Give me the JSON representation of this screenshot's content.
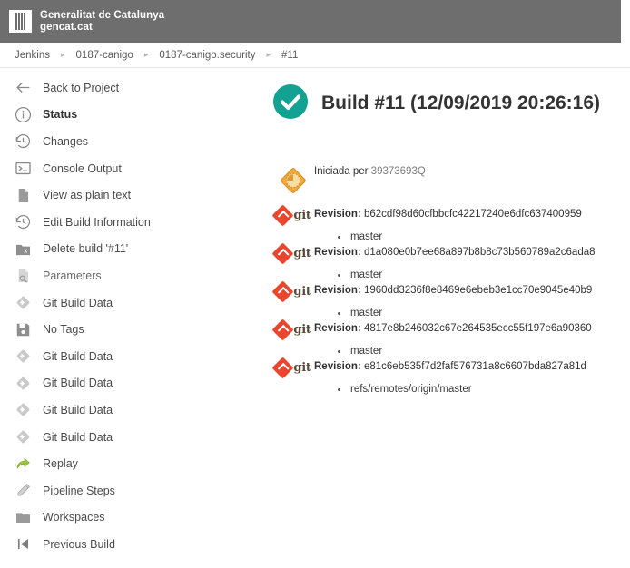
{
  "banner": {
    "org_line1": "Generalitat de Catalunya",
    "org_line2": "gencat.cat",
    "logo_icon": "catalan-flag-icon",
    "bg": "#6e6e6e"
  },
  "breadcrumb": {
    "separator": "▸",
    "items": [
      {
        "label": "Jenkins"
      },
      {
        "label": "0187-canigo"
      },
      {
        "label": "0187-canigo.security"
      },
      {
        "label": "#11"
      }
    ]
  },
  "sidebar": {
    "items": [
      {
        "label": "Back to Project",
        "icon": "arrow-left-icon",
        "state": "normal"
      },
      {
        "label": "Status",
        "icon": "info-icon",
        "state": "active"
      },
      {
        "label": "Changes",
        "icon": "history-icon",
        "state": "normal"
      },
      {
        "label": "Console Output",
        "icon": "terminal-icon",
        "state": "normal"
      },
      {
        "label": "View as plain text",
        "icon": "document-icon",
        "state": "normal"
      },
      {
        "label": "Edit Build Information",
        "icon": "history-icon",
        "state": "normal"
      },
      {
        "label": "Delete build '#11'",
        "icon": "folder-delete-icon",
        "state": "normal"
      },
      {
        "label": "Parameters",
        "icon": "document-search-icon",
        "state": "dim"
      },
      {
        "label": "Git Build Data",
        "icon": "git-diamond-icon",
        "state": "normal"
      },
      {
        "label": "No Tags",
        "icon": "save-icon",
        "state": "normal"
      },
      {
        "label": "Git Build Data",
        "icon": "git-diamond-icon",
        "state": "normal"
      },
      {
        "label": "Git Build Data",
        "icon": "git-diamond-icon",
        "state": "normal"
      },
      {
        "label": "Git Build Data",
        "icon": "git-diamond-icon",
        "state": "normal"
      },
      {
        "label": "Git Build Data",
        "icon": "git-diamond-icon",
        "state": "normal"
      },
      {
        "label": "Replay",
        "icon": "replay-arrow-icon",
        "state": "normal"
      },
      {
        "label": "Pipeline Steps",
        "icon": "pencil-icon",
        "state": "normal"
      },
      {
        "label": "Workspaces",
        "icon": "folder-icon",
        "state": "normal"
      },
      {
        "label": "Previous Build",
        "icon": "previous-build-icon",
        "state": "normal"
      }
    ]
  },
  "build": {
    "status_icon": "success-check-icon",
    "status_color": "#12a192",
    "title": "Build #11 (12/09/2019 20:26:16)",
    "cause": {
      "icon": "user-started-icon",
      "prefix": "Iniciada per",
      "user": "39373693Q"
    },
    "revision_label": "Revision:",
    "revisions": [
      {
        "icon": "git-logo-icon",
        "sha": "b62cdf98d60cfbbcfc42217240e6dfc637400959",
        "branches": [
          "master"
        ]
      },
      {
        "icon": "git-logo-icon",
        "sha": "d1a080e0b7ee68a897b8b8c73b560789a2c6ada8",
        "branches": [
          "master"
        ]
      },
      {
        "icon": "git-logo-icon",
        "sha": "1960dd3236f8e8469e6ebeb3e1cc70e9045e40b9",
        "branches": [
          "master"
        ]
      },
      {
        "icon": "git-logo-icon",
        "sha": "4817e8b246032c67e264535ecc55f197e6a90360",
        "branches": [
          "master"
        ]
      },
      {
        "icon": "git-logo-icon",
        "sha": "e81c6eb535f7d2faf576731a8c6607bda827a81d",
        "branches": [
          "refs/remotes/origin/master"
        ]
      }
    ]
  }
}
